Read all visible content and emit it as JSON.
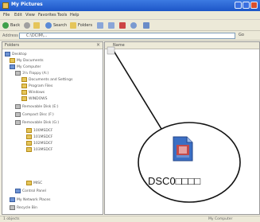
{
  "window": {
    "title": "My Pictures",
    "address_label": "Address",
    "address_value": "C:\\DCIM\\...",
    "go_label": "Go"
  },
  "menu": [
    "File",
    "Edit",
    "View",
    "Favorites",
    "Tools",
    "Help"
  ],
  "toolbar": {
    "back": "Back",
    "search": "Search",
    "folders": "Folders"
  },
  "left_pane": {
    "header": "Folders",
    "close": "×",
    "tree": [
      {
        "label": "Desktop"
      },
      {
        "label": "My Documents"
      },
      {
        "label": "My Computer"
      },
      {
        "label": "3½ Floppy (A:)"
      },
      {
        "label": "Documents and Settings"
      },
      {
        "label": "Program Files"
      },
      {
        "label": "Windows"
      },
      {
        "label": "WINDOWS"
      },
      {
        "label": "Removable Disk (E:)"
      },
      {
        "label": "Compact Disc (F:)"
      },
      {
        "label": "Removable Disk (G:)"
      },
      {
        "label": "100MSDCF"
      },
      {
        "label": "101MSDCF"
      },
      {
        "label": "102MSDCF"
      },
      {
        "label": "103MSDCF"
      },
      {
        "label": "MISC"
      },
      {
        "label": "Control Panel"
      },
      {
        "label": "My Network Places"
      },
      {
        "label": "Recycle Bin"
      }
    ]
  },
  "right_pane": {
    "header": "Name"
  },
  "callout": {
    "filename": "DSC0□□□□",
    "icon": "image-file-icon"
  },
  "status": {
    "left": "1 objects",
    "mid": "My Computer"
  },
  "colors": {
    "titlebar": "#1d56c7",
    "chrome": "#ece9d8",
    "folder": "#e5c55a"
  }
}
